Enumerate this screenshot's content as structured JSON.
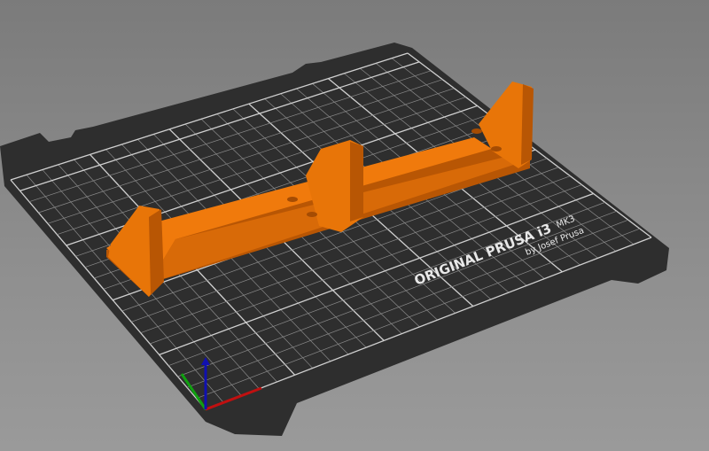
{
  "viewport": {
    "name": "3D scene"
  },
  "bed": {
    "logo_line1": "ORIGINAL PRUSA i3",
    "logo_model": "MK3",
    "logo_line2": "by Josef Prusa",
    "size_x_cm": 25,
    "size_y_cm": 21
  },
  "colors": {
    "bed": "#2e2e2e",
    "grid": "#8a8a8a",
    "object_top": "#f07a0c",
    "object_side": "#c65f05",
    "axis_x": "#c01010",
    "axis_y": "#10a010",
    "axis_z": "#1010b0"
  }
}
